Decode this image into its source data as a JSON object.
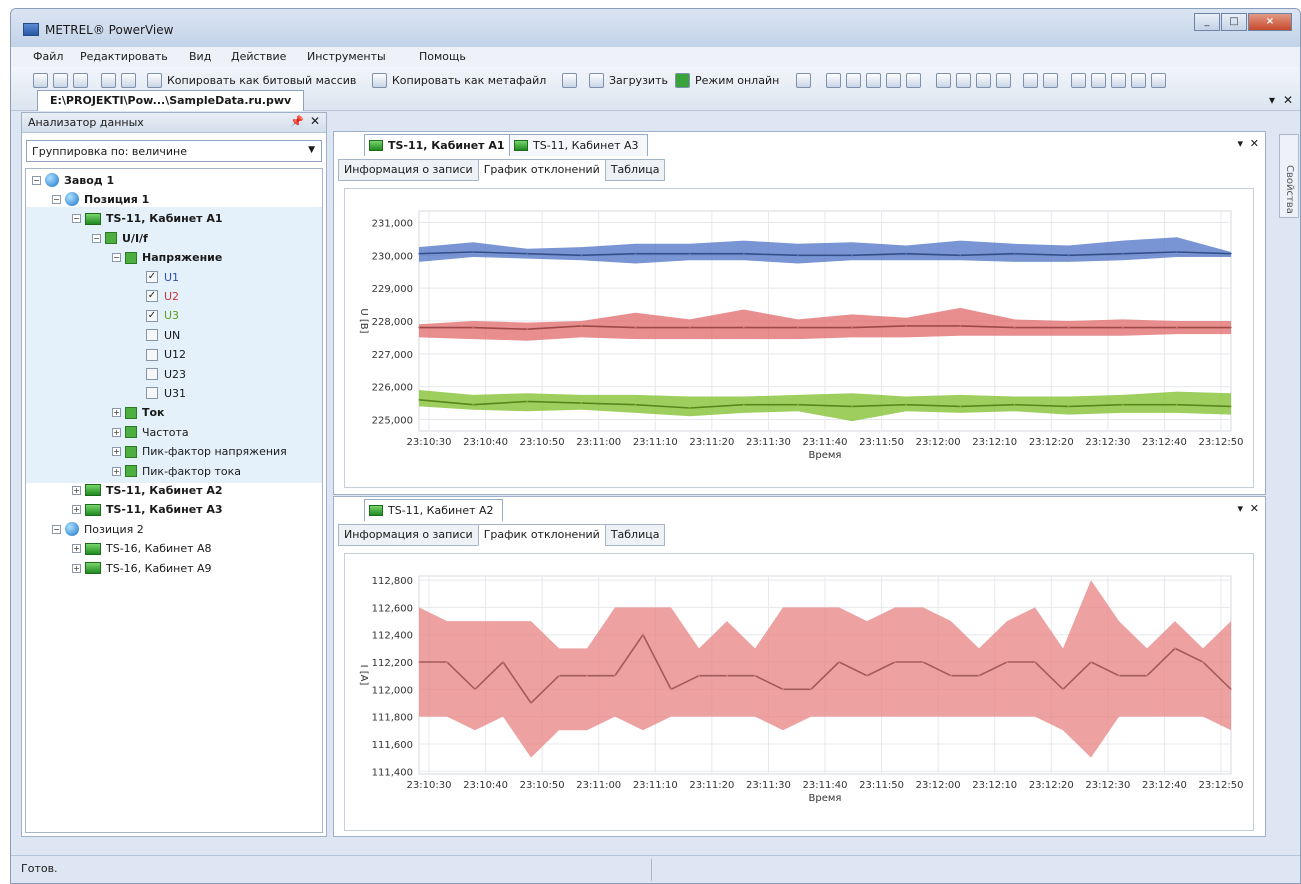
{
  "window": {
    "title": "METREL® PowerView"
  },
  "menu": [
    "Файл",
    "Редактировать",
    "Вид",
    "Действие",
    "Инструменты",
    "Помощь"
  ],
  "toolbar": {
    "copy_bitmap": "Копировать как битовый массив",
    "copy_metafile": "Копировать как метафайл",
    "download": "Загрузить",
    "online_mode": "Режим онлайн"
  },
  "document_tab": "E:\\PROJEKTI\\Pow...\\SampleData.ru.pwv",
  "analyzer": {
    "title": "Анализатор данных",
    "pin_icon": "pin-icon",
    "grouping": "Группировка по: величине",
    "tree": [
      {
        "label": "Завод 1",
        "icon": "globe",
        "bold": true,
        "exp": "−"
      },
      {
        "label": "Позиция 1",
        "icon": "globe",
        "bold": true,
        "exp": "−"
      },
      {
        "label": "TS-11, Кабинет A1",
        "icon": "instrument",
        "bold": true,
        "exp": "−"
      },
      {
        "label": "U/I/f",
        "icon": "measure",
        "bold": true,
        "exp": "−"
      },
      {
        "label": "Напряжение",
        "icon": "measure",
        "bold": true,
        "exp": "−"
      },
      {
        "label": "U1",
        "checked": true,
        "color": "#2c4fb5"
      },
      {
        "label": "U2",
        "checked": true,
        "color": "#cc3333"
      },
      {
        "label": "U3",
        "checked": true,
        "color": "#5aa01e"
      },
      {
        "label": "UN",
        "checked": false
      },
      {
        "label": "U12",
        "checked": false
      },
      {
        "label": "U23",
        "checked": false
      },
      {
        "label": "U31",
        "checked": false
      },
      {
        "label": "Ток",
        "icon": "measure",
        "bold": true,
        "exp": "+"
      },
      {
        "label": "Частота",
        "icon": "measure",
        "exp": "+"
      },
      {
        "label": "Пик-фактор напряжения",
        "icon": "measure",
        "exp": "+"
      },
      {
        "label": "Пик-фактор тока",
        "icon": "measure",
        "exp": "+"
      },
      {
        "label": "TS-11, Кабинет A2",
        "icon": "instrument",
        "bold": true,
        "exp": "+"
      },
      {
        "label": "TS-11, Кабинет A3",
        "icon": "instrument",
        "bold": true,
        "exp": "+"
      },
      {
        "label": "Позиция 2",
        "icon": "globe",
        "exp": "−"
      },
      {
        "label": "TS-16, Кабинет A8",
        "icon": "instrument",
        "exp": "+"
      },
      {
        "label": "TS-16, Кабинет A9",
        "icon": "instrument",
        "exp": "+"
      }
    ]
  },
  "panel_top": {
    "tabs": [
      "TS-11, Кабинет A1",
      "TS-11, Кабинет A3"
    ],
    "subtabs": [
      "Информация о записи",
      "График отклонений",
      "Таблица"
    ]
  },
  "panel_bottom": {
    "tabs": [
      "TS-11, Кабинет A2"
    ],
    "subtabs": [
      "Информация о записи",
      "График отклонений",
      "Таблица"
    ]
  },
  "properties_label": "Свойства",
  "status": "Готов.",
  "chart_data": [
    {
      "type": "area",
      "xlabel": "Время",
      "ylabel": "U [В]",
      "ylim": [
        224.65,
        231.35
      ],
      "yticks": [
        "231,000",
        "230,000",
        "229,000",
        "228,000",
        "227,000",
        "226,000",
        "225,000"
      ],
      "yvalues": [
        231,
        230,
        229,
        228,
        227,
        226,
        225
      ],
      "x": [
        "23:10:30",
        "23:10:40",
        "23:10:50",
        "23:11:00",
        "23:11:10",
        "23:11:20",
        "23:11:30",
        "23:11:40",
        "23:11:50",
        "23:12:00",
        "23:12:10",
        "23:12:20",
        "23:12:30",
        "23:12:40",
        "23:12:50"
      ],
      "grid": true,
      "series": [
        {
          "color": "#4c72c4",
          "values": [
            230.05,
            230.1,
            230.05,
            230.0,
            230.05,
            230.05,
            230.05,
            230.0,
            230.0,
            230.05,
            230.0,
            230.05,
            230.0,
            230.05,
            230.1,
            230.05
          ],
          "max": [
            230.25,
            230.4,
            230.2,
            230.25,
            230.35,
            230.35,
            230.45,
            230.35,
            230.4,
            230.3,
            230.45,
            230.35,
            230.3,
            230.45,
            230.55,
            230.1
          ],
          "min": [
            229.8,
            229.95,
            229.9,
            229.85,
            229.75,
            229.85,
            229.85,
            229.75,
            229.85,
            229.85,
            229.85,
            229.8,
            229.8,
            229.85,
            229.95,
            229.95
          ]
        },
        {
          "color": "#e06868",
          "values": [
            227.8,
            227.8,
            227.75,
            227.85,
            227.8,
            227.8,
            227.8,
            227.8,
            227.8,
            227.85,
            227.85,
            227.8,
            227.8,
            227.8,
            227.8,
            227.8
          ],
          "max": [
            227.9,
            228.0,
            227.95,
            228.0,
            228.25,
            228.05,
            228.35,
            228.05,
            228.2,
            228.1,
            228.4,
            228.05,
            228.0,
            228.05,
            228.0,
            228.0
          ],
          "min": [
            227.5,
            227.45,
            227.4,
            227.5,
            227.45,
            227.45,
            227.45,
            227.45,
            227.5,
            227.5,
            227.55,
            227.55,
            227.55,
            227.55,
            227.6,
            227.6
          ]
        },
        {
          "color": "#7dbf28",
          "values": [
            225.6,
            225.45,
            225.55,
            225.5,
            225.45,
            225.35,
            225.45,
            225.45,
            225.4,
            225.45,
            225.4,
            225.45,
            225.4,
            225.45,
            225.45,
            225.4
          ],
          "max": [
            225.9,
            225.75,
            225.8,
            225.75,
            225.75,
            225.7,
            225.7,
            225.75,
            225.8,
            225.7,
            225.75,
            225.7,
            225.7,
            225.75,
            225.85,
            225.8
          ],
          "min": [
            225.4,
            225.3,
            225.25,
            225.3,
            225.2,
            225.1,
            225.2,
            225.25,
            224.95,
            225.25,
            225.2,
            225.25,
            225.15,
            225.2,
            225.2,
            225.15
          ]
        }
      ]
    },
    {
      "type": "area",
      "xlabel": "Время",
      "ylabel": "I [A]",
      "ylim": [
        111.38,
        112.83
      ],
      "yticks": [
        "112,800",
        "112,600",
        "112,400",
        "112,200",
        "112,000",
        "111,800",
        "111,600",
        "111,400"
      ],
      "yvalues": [
        112.8,
        112.6,
        112.4,
        112.2,
        112.0,
        111.8,
        111.6,
        111.4
      ],
      "x": [
        "23:10:30",
        "23:10:40",
        "23:10:50",
        "23:11:00",
        "23:11:10",
        "23:11:20",
        "23:11:30",
        "23:11:40",
        "23:11:50",
        "23:12:00",
        "23:12:10",
        "23:12:20",
        "23:12:30",
        "23:12:40",
        "23:12:50"
      ],
      "grid": true,
      "series": [
        {
          "color": "#e88282",
          "values": [
            112.2,
            112.2,
            112.0,
            112.2,
            111.9,
            112.1,
            112.1,
            112.1,
            112.4,
            112.0,
            112.1,
            112.1,
            112.1,
            112.0,
            112.0,
            112.2,
            112.1,
            112.2,
            112.2,
            112.1,
            112.1,
            112.2,
            112.2,
            112.0,
            112.2,
            112.1,
            112.1,
            112.3,
            112.2,
            112.0
          ],
          "max": [
            112.6,
            112.5,
            112.5,
            112.5,
            112.5,
            112.3,
            112.3,
            112.6,
            112.6,
            112.6,
            112.3,
            112.5,
            112.3,
            112.6,
            112.6,
            112.6,
            112.5,
            112.6,
            112.6,
            112.5,
            112.3,
            112.5,
            112.6,
            112.3,
            112.8,
            112.5,
            112.3,
            112.5,
            112.3,
            112.5
          ],
          "min": [
            111.8,
            111.8,
            111.7,
            111.8,
            111.5,
            111.7,
            111.7,
            111.8,
            111.7,
            111.8,
            111.8,
            111.8,
            111.8,
            111.7,
            111.8,
            111.8,
            111.8,
            111.8,
            111.8,
            111.8,
            111.8,
            111.8,
            111.8,
            111.7,
            111.5,
            111.8,
            111.8,
            111.8,
            111.8,
            111.7
          ]
        }
      ]
    }
  ]
}
